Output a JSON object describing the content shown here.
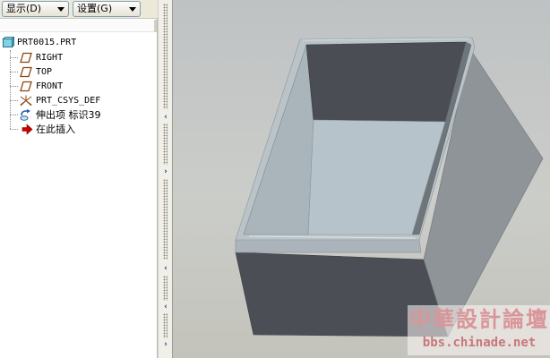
{
  "toolbar": {
    "display_label": "显示(D)",
    "settings_label": "设置(G)"
  },
  "model_tree": {
    "items": [
      {
        "label": "PRT0015.PRT",
        "icon": "part-icon"
      },
      {
        "label": "RIGHT",
        "icon": "datum-plane-icon"
      },
      {
        "label": "TOP",
        "icon": "datum-plane-icon"
      },
      {
        "label": "FRONT",
        "icon": "datum-plane-icon"
      },
      {
        "label": "PRT_CSYS_DEF",
        "icon": "coordinate-system-icon"
      },
      {
        "label": "伸出项 标识39",
        "icon": "protrusion-feature-icon"
      },
      {
        "label": "在此插入",
        "icon": "insert-here-arrow-icon"
      }
    ]
  },
  "watermark": {
    "title": "中華設計論壇",
    "url": "bbs.chinade.net"
  },
  "colors": {
    "accent": "#1d3a9e",
    "datum_icon": "#8b4513",
    "insert_arrow": "#cc0000",
    "part_icon": "#7fd3e6",
    "watermark": "#d9969a"
  }
}
